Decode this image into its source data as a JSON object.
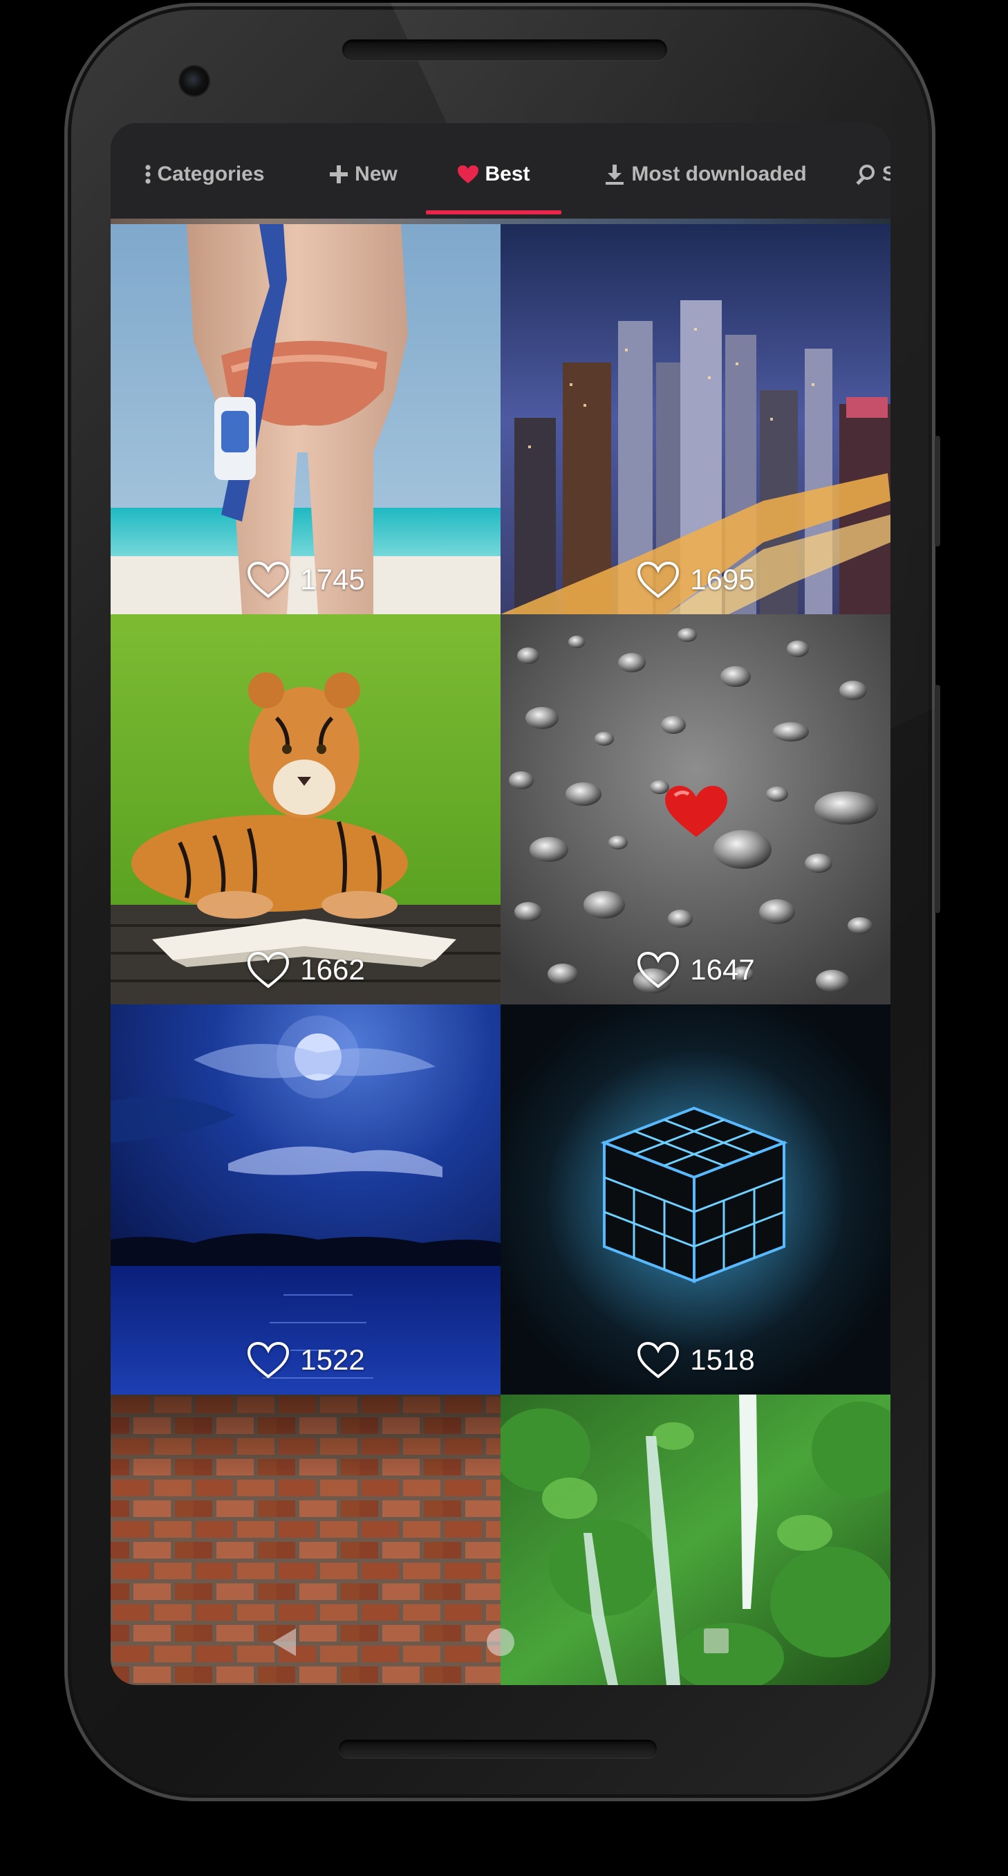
{
  "tabs": [
    {
      "id": "categories",
      "label": "Categories",
      "icon": "more-vertical-icon",
      "active": false
    },
    {
      "id": "new",
      "label": "New",
      "icon": "plus-icon",
      "active": false
    },
    {
      "id": "best",
      "label": "Best",
      "icon": "heart-icon",
      "active": true
    },
    {
      "id": "most_downloaded",
      "label": "Most downloaded",
      "icon": "download-icon",
      "active": false
    },
    {
      "id": "search",
      "label": "S",
      "icon": "search-icon",
      "active": false
    }
  ],
  "colors": {
    "accent": "#e8254a",
    "tab_bar": "#242426",
    "tab_text": "#b8b8b8",
    "tab_text_active": "#ffffff"
  },
  "wallpapers": [
    {
      "subject": "beach-snorkel",
      "likes": "1745"
    },
    {
      "subject": "city-night-skyline",
      "likes": "1695"
    },
    {
      "subject": "tiger-on-book",
      "likes": "1662"
    },
    {
      "subject": "water-drops-red-heart",
      "likes": "1647"
    },
    {
      "subject": "moonlit-blue-lake",
      "likes": "1522"
    },
    {
      "subject": "glowing-cube",
      "likes": "1518"
    },
    {
      "subject": "brick-wall",
      "likes": ""
    },
    {
      "subject": "jungle-waterfall",
      "likes": ""
    }
  ],
  "navbar": {
    "buttons": [
      "back-icon",
      "home-icon",
      "recents-icon"
    ]
  }
}
